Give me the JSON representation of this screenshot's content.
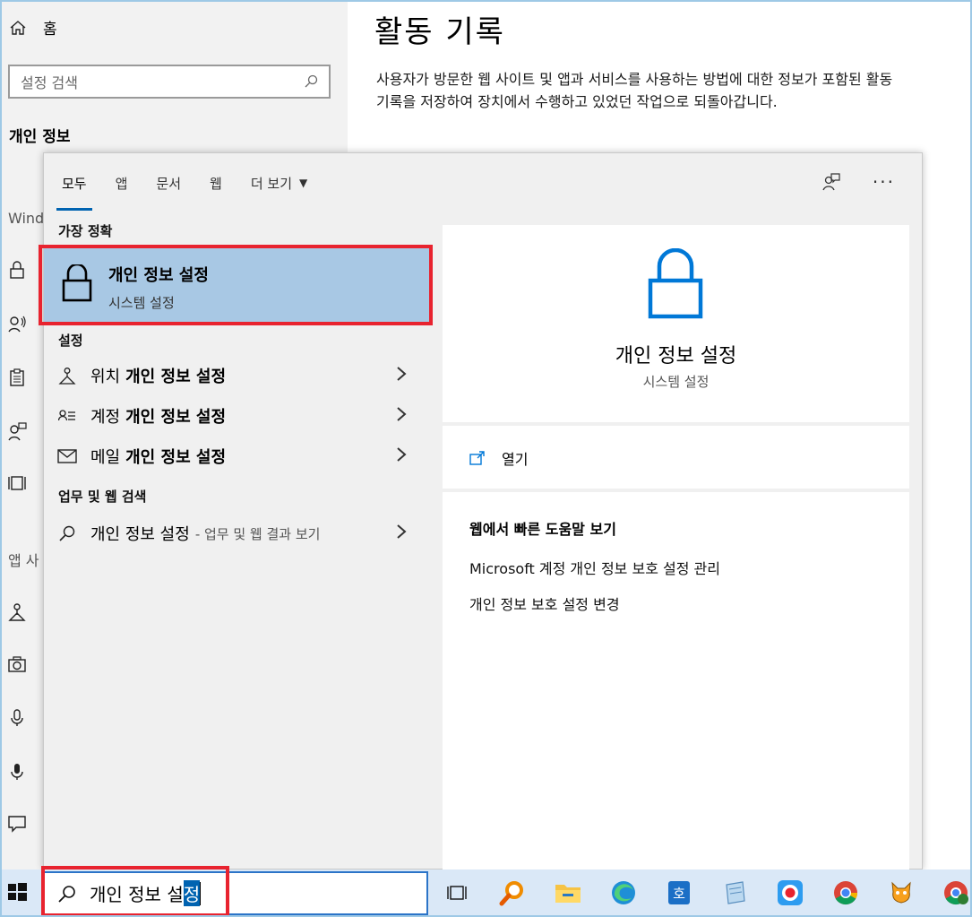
{
  "settings": {
    "home_label": "홈",
    "search_placeholder": "설정 검색",
    "section_title": "개인 정보",
    "partial_windows": "Wind",
    "partial_apps": "앱 사",
    "page_title": "활동 기록",
    "description": "사용자가 방문한 웹 사이트 및 앱과 서비스를 사용하는 방법에 대한 정보가 포함된 활동 기록을 저장하여 장치에서 수행하고 있었던 작업으로 되돌아갑니다."
  },
  "flyout": {
    "tabs": [
      {
        "label": "모두"
      },
      {
        "label": "앱"
      },
      {
        "label": "문서"
      },
      {
        "label": "웹"
      },
      {
        "label": "더 보기"
      }
    ],
    "best_match_header": "가장 정확",
    "best_match": {
      "title": "개인 정보 설정",
      "subtitle": "시스템 설정"
    },
    "settings_header": "설정",
    "settings_results": [
      {
        "prefix": "위치",
        "bold": "개인 정보 설정",
        "icon": "location-icon"
      },
      {
        "prefix": "계정",
        "bold": "개인 정보 설정",
        "icon": "account-list-icon"
      },
      {
        "prefix": "메일",
        "bold": "개인 정보 설정",
        "icon": "mail-icon"
      }
    ],
    "web_header": "업무 및 웹 검색",
    "web_result": {
      "query": "개인 정보 설정",
      "suffix": "- 업무 및 웹 결과 보기"
    },
    "preview": {
      "title": "개인 정보 설정",
      "subtitle": "시스템 설정",
      "open_label": "열기",
      "help_header": "웹에서 빠른 도움말 보기",
      "links": [
        "Microsoft 계정 개인 정보 보호 설정 관리",
        "개인 정보 보호 설정 변경"
      ]
    }
  },
  "taskbar": {
    "search_text_plain": "개인 정보 설",
    "search_text_selected": "정"
  },
  "colors": {
    "accent": "#0063b1",
    "highlight_box": "#e8232f",
    "best_match_bg": "#a8c8e4",
    "taskbar_bg": "#dae8f7"
  }
}
